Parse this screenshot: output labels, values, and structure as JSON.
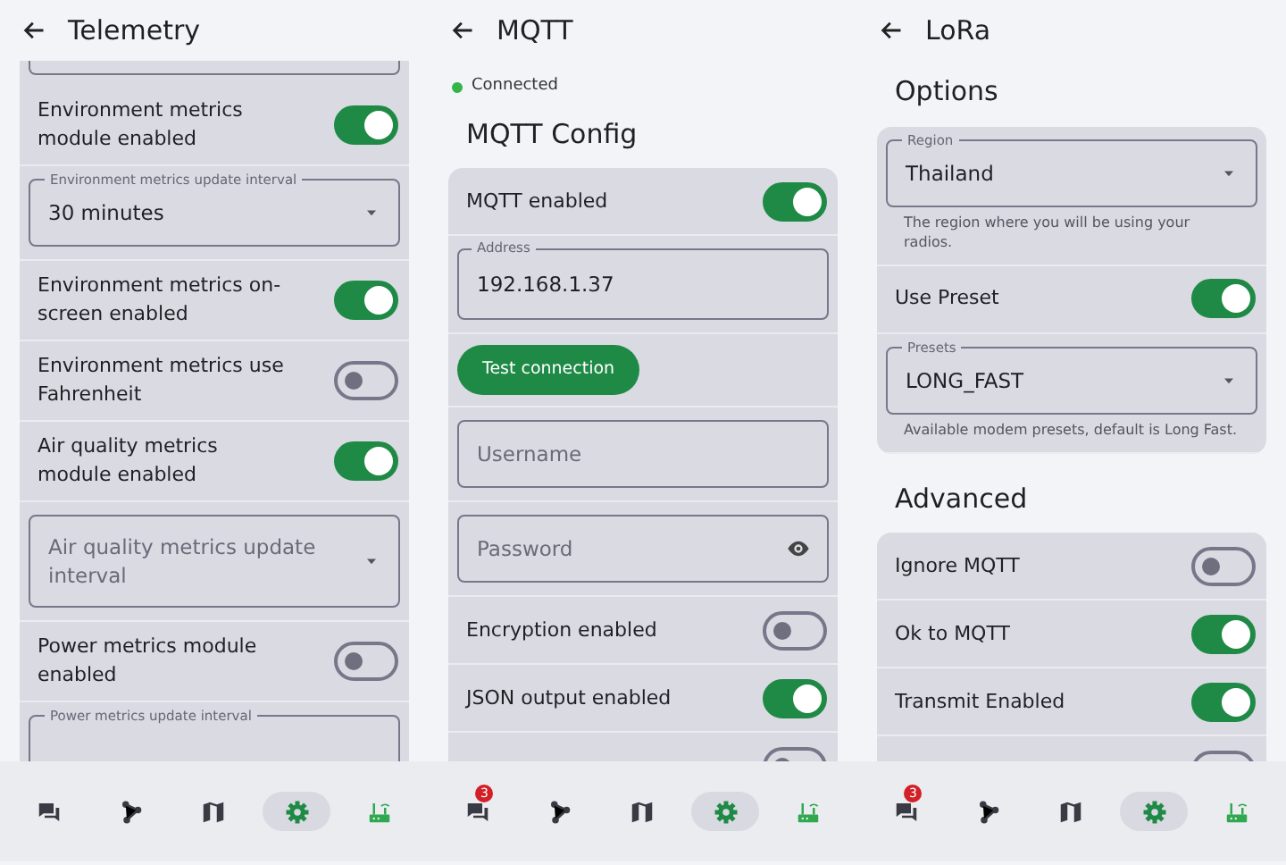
{
  "screens": [
    {
      "title": "Telemetry",
      "sections": [
        {
          "card": [
            {
              "kind": "field_end"
            },
            {
              "kind": "toggle",
              "label": "Environment metrics module enabled",
              "on": true
            },
            {
              "kind": "select",
              "label": "Environment metrics update interval",
              "value": "30 minutes"
            },
            {
              "kind": "toggle",
              "label": "Environment metrics on-screen enabled",
              "on": true
            },
            {
              "kind": "toggle",
              "label": "Environment metrics use Fahrenheit",
              "on": false
            },
            {
              "kind": "toggle",
              "label": "Air quality metrics module enabled",
              "on": true
            },
            {
              "kind": "select",
              "placeholder": "Air quality metrics update interval"
            },
            {
              "kind": "toggle",
              "label": "Power metrics module enabled",
              "on": false
            },
            {
              "kind": "select",
              "label": "Power metrics update interval"
            }
          ]
        }
      ],
      "nav": [
        {
          "kind": "messages",
          "selected": false
        },
        {
          "kind": "nodes",
          "selected": false
        },
        {
          "kind": "map",
          "selected": false
        },
        {
          "kind": "settings",
          "selected": true
        },
        {
          "kind": "connection",
          "selected": false,
          "connected": true
        }
      ]
    },
    {
      "title": "MQTT",
      "status": {
        "label": "Connected",
        "connected": true
      },
      "sections": [
        {
          "heading": "MQTT Config",
          "card": [
            {
              "kind": "toggle",
              "label": "MQTT enabled",
              "on": true
            },
            {
              "kind": "text",
              "label": "Address",
              "value": "192.168.1.37"
            },
            {
              "kind": "button",
              "label": "Test connection"
            },
            {
              "kind": "text",
              "placeholder": "Username"
            },
            {
              "kind": "password",
              "placeholder": "Password"
            },
            {
              "kind": "toggle",
              "label": "Encryption enabled",
              "on": false
            },
            {
              "kind": "toggle",
              "label": "JSON output enabled",
              "on": true
            },
            {
              "kind": "toggle_cut",
              "on": false
            }
          ]
        }
      ],
      "nav": [
        {
          "kind": "messages",
          "selected": false,
          "badge": "3"
        },
        {
          "kind": "nodes",
          "selected": false
        },
        {
          "kind": "map",
          "selected": false
        },
        {
          "kind": "settings",
          "selected": true
        },
        {
          "kind": "connection",
          "selected": false,
          "connected": true
        }
      ]
    },
    {
      "title": "LoRa",
      "sections": [
        {
          "heading": "Options",
          "card": [
            {
              "kind": "select",
              "label": "Region",
              "value": "Thailand",
              "helper": "The region where you will be using your radios."
            },
            {
              "kind": "toggle",
              "label": "Use Preset",
              "on": true
            },
            {
              "kind": "select",
              "label": "Presets",
              "value": "LONG_FAST",
              "helper": "Available modem presets, default is Long Fast."
            }
          ]
        },
        {
          "heading": "Advanced",
          "card": [
            {
              "kind": "toggle",
              "label": "Ignore MQTT",
              "on": false
            },
            {
              "kind": "toggle",
              "label": "Ok to MQTT",
              "on": true
            },
            {
              "kind": "toggle",
              "label": "Transmit Enabled",
              "on": true
            },
            {
              "kind": "toggle_cut",
              "on": false
            }
          ]
        }
      ],
      "nav": [
        {
          "kind": "messages",
          "selected": false,
          "badge": "3"
        },
        {
          "kind": "nodes",
          "selected": false
        },
        {
          "kind": "map",
          "selected": false
        },
        {
          "kind": "settings",
          "selected": true
        },
        {
          "kind": "connection",
          "selected": false,
          "connected": true
        }
      ]
    }
  ]
}
